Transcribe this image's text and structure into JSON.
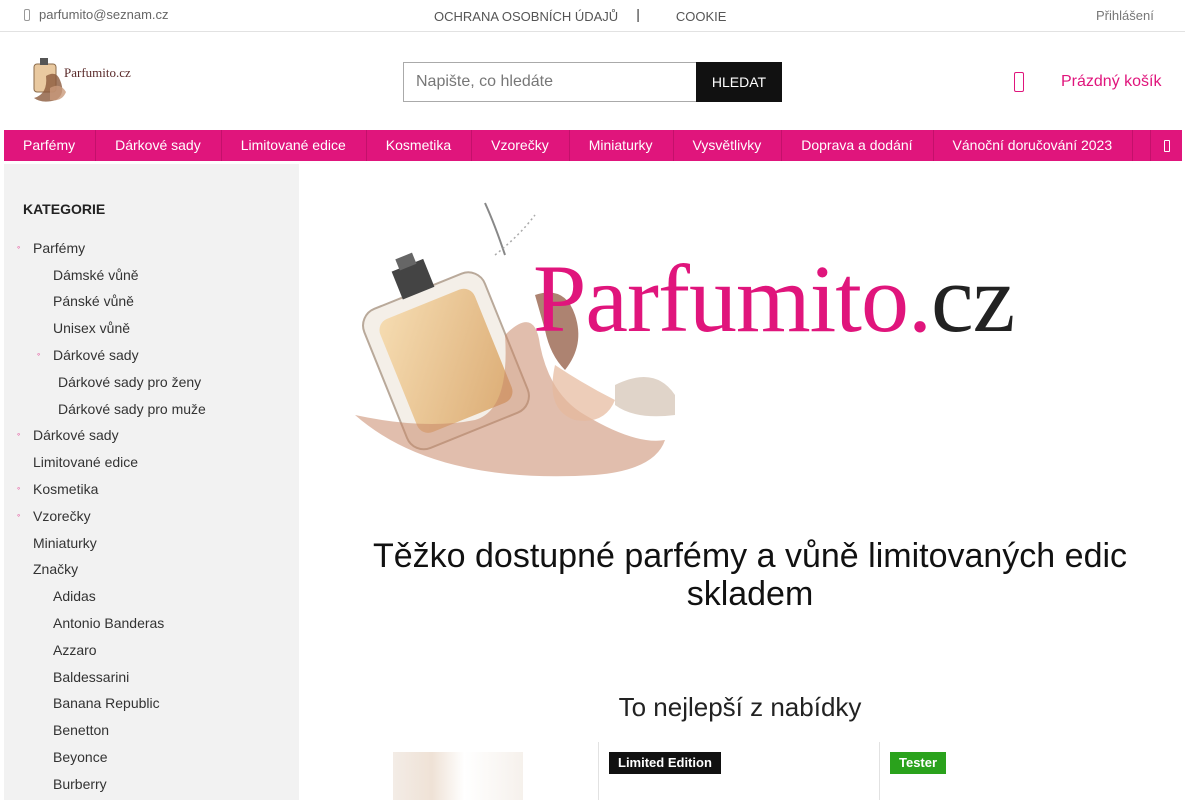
{
  "topbar": {
    "email": "parfumito@seznam.cz",
    "privacy_link": "OCHRANA OSOBNÍCH ÚDAJŮ",
    "separator": "|",
    "cookie_link": "COOKIE",
    "login": "Přihlášení"
  },
  "header": {
    "logo_text": "Parfumito.cz",
    "search_placeholder": "Napište, co hledáte",
    "search_button": "HLEDAT",
    "cart_label": "Prázdný košík"
  },
  "nav": {
    "items": [
      "Parfémy",
      "Dárkové sady",
      "Limitované edice",
      "Kosmetika",
      "Vzorečky",
      "Miniaturky",
      "Vysvětlivky",
      "Doprava a dodání",
      "Vánoční doručování 2023"
    ]
  },
  "sidebar": {
    "title": "KATEGORIE",
    "items": [
      {
        "label": "Parfémy"
      },
      {
        "label": "Dámské vůně"
      },
      {
        "label": "Pánské vůně"
      },
      {
        "label": "Unisex vůně"
      },
      {
        "label": "Dárkové sady"
      },
      {
        "label": "Dárkové sady pro ženy"
      },
      {
        "label": "Dárkové sady pro muže"
      },
      {
        "label": "Dárkové sady"
      },
      {
        "label": "Limitované edice"
      },
      {
        "label": "Kosmetika"
      },
      {
        "label": "Vzorečky"
      },
      {
        "label": "Miniaturky"
      },
      {
        "label": "Značky"
      },
      {
        "label": "Adidas"
      },
      {
        "label": "Antonio Banderas"
      },
      {
        "label": "Azzaro"
      },
      {
        "label": "Baldessarini"
      },
      {
        "label": "Banana Republic"
      },
      {
        "label": "Benetton"
      },
      {
        "label": "Beyonce"
      },
      {
        "label": "Burberry"
      }
    ]
  },
  "main": {
    "hero_brand": "Parfumito.",
    "hero_brand_suffix": "cz",
    "heading": "Těžko dostupné parfémy a vůně limitovaných edic skladem",
    "subheading": "To nejlepší z nabídky",
    "badges": {
      "limited": "Limited Edition",
      "tester": "Tester"
    }
  },
  "colors": {
    "accent": "#e0157c",
    "button_dark": "#111111",
    "tester_green": "#2aa21c",
    "sidebar_bg": "#f2f2f2"
  },
  "icons": {
    "email": "phone-icon",
    "cart": "cart-icon",
    "nav_more": "menu-more-icon"
  }
}
